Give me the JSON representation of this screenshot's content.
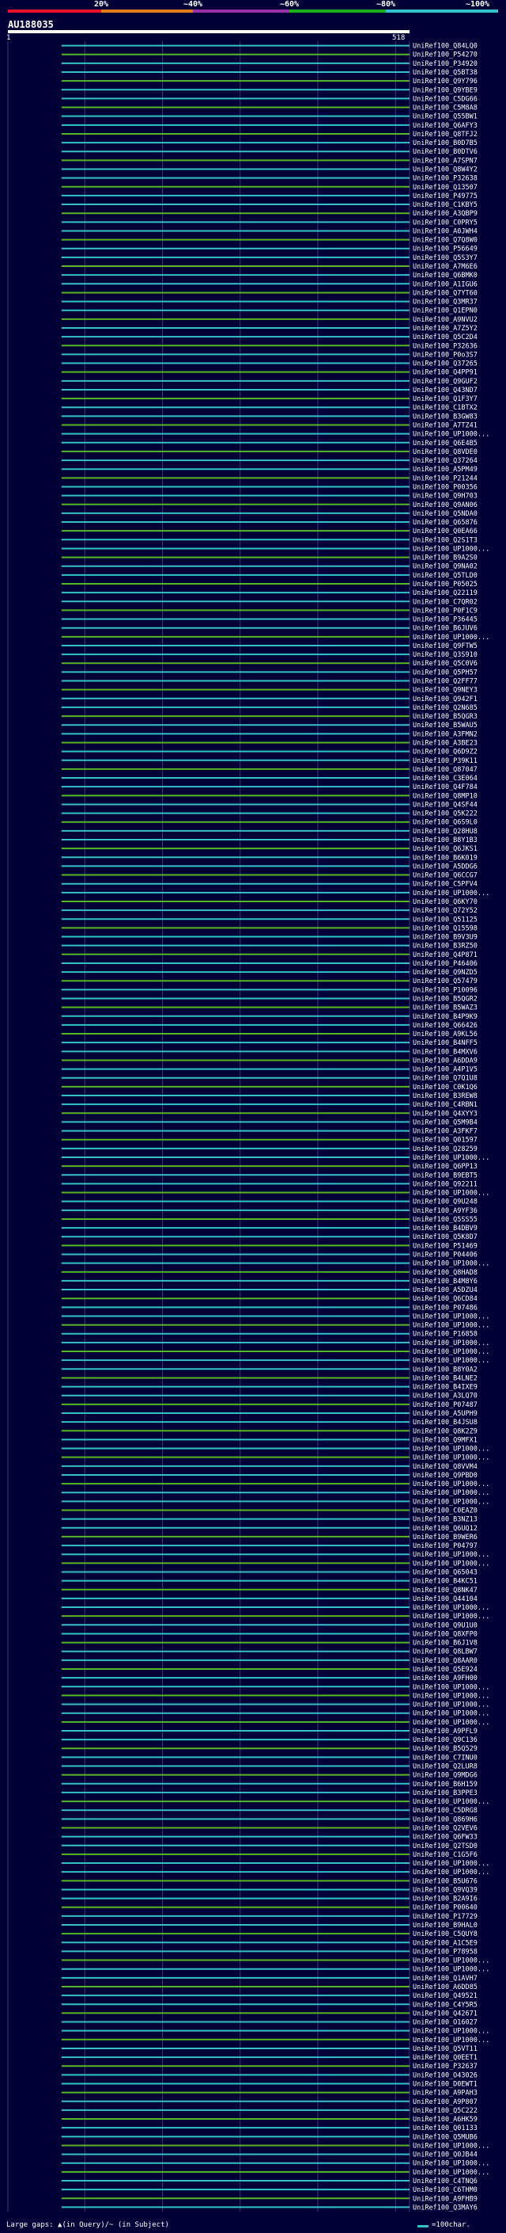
{
  "header": {
    "query_name": "AU188035",
    "query_start": "1",
    "query_end": "518",
    "percent_labels": [
      "20%",
      "~40%",
      "~60%",
      "~80%",
      "~100%"
    ],
    "percent_colors": [
      "#e8102a",
      "#e07b1c",
      "#9b2fa8",
      "#1cad1a",
      "#33c2cc"
    ]
  },
  "colors": {
    "background": "#000036",
    "query_bar": "#ffffff",
    "cyan_hit": "#33c2cc",
    "green_hit": "#55b925",
    "grid": "#3a3a7a"
  },
  "legend": {
    "gaps_text": "Large gaps: ▲(in Query)/~ (in Subject)",
    "scale_text": "=100char."
  },
  "chart_data": {
    "type": "bar",
    "title": "",
    "xlabel": "",
    "ylabel": "",
    "xlim": [
      1,
      518
    ],
    "categories": [
      "UniRef100_Q84LQ0",
      "UniRef100_P54270",
      "UniRef100_P34920",
      "UniRef100_Q5BT38",
      "UniRef100_Q9Y796",
      "UniRef100_Q9YBE9",
      "UniRef100_C5DG66",
      "UniRef100_C5M8A8",
      "UniRef100_Q55BW1",
      "UniRef100_Q6AFY3",
      "UniRef100_Q8TFJ2",
      "UniRef100_B0D7B5",
      "UniRef100_B0DTV6",
      "UniRef100_A7SPN7",
      "UniRef100_Q8W4Y2",
      "UniRef100_P32638",
      "UniRef100_Q13507",
      "UniRef100_P49775",
      "UniRef100_C1KBY5",
      "UniRef100_A3QBP9",
      "UniRef100_C0PRY5",
      "UniRef100_A0JWH4",
      "UniRef100_Q7Q8W0",
      "UniRef100_P56649",
      "UniRef100_Q5S3Y7",
      "UniRef100_A7M6E6",
      "UniRef100_Q6BMK0",
      "UniRef100_A1IGU6",
      "UniRef100_Q7YT60",
      "UniRef100_Q3MR37",
      "UniRef100_Q1EPN0",
      "UniRef100_A9NVU2",
      "UniRef100_A7Z5Y2",
      "UniRef100_Q5C2D4",
      "UniRef100_P32636",
      "UniRef100_P0o3S7",
      "UniRef100_Q37265",
      "UniRef100_Q4PP91",
      "UniRef100_Q9GUF2",
      "UniRef100_Q43ND7",
      "UniRef100_Q1F3Y7",
      "UniRef100_C1BTX2",
      "UniRef100_B3GW83",
      "UniRef100_A7TZ41",
      "UniRef100_UP1000...",
      "UniRef100_Q6E4B5",
      "UniRef100_Q8VDE0",
      "UniRef100_Q37264",
      "UniRef100_A5PM49",
      "UniRef100_P21244",
      "UniRef100_P00356",
      "UniRef100_Q9H703",
      "UniRef100_Q9AN06",
      "UniRef100_Q5NDA0",
      "UniRef100_Q65876",
      "UniRef100_Q0EA66",
      "UniRef100_Q2S1T3",
      "UniRef100_UP1000...",
      "UniRef100_B9A2S0",
      "UniRef100_Q9NA02",
      "UniRef100_Q5TLD0",
      "UniRef100_P05025",
      "UniRef100_Q22119",
      "UniRef100_C7QR02",
      "UniRef100_P0F1C9",
      "UniRef100_P36445",
      "UniRef100_B6JUV6",
      "UniRef100_UP1000...",
      "UniRef100_Q9FTW5",
      "UniRef100_Q3S910",
      "UniRef100_Q5C0V6",
      "UniRef100_Q5PH57",
      "UniRef100_Q2FF77",
      "UniRef100_Q9NEY3",
      "UniRef100_Q942F1",
      "UniRef100_Q2N685",
      "UniRef100_B5QGR3",
      "UniRef100_B5WAU5",
      "UniRef100_A3FMN2",
      "UniRef100_A3BE23",
      "UniRef100_Q6D9Z2",
      "UniRef100_P39K11",
      "UniRef100_Q87047",
      "UniRef100_C3E064",
      "UniRef100_Q4F784",
      "UniRef100_Q8MP10",
      "UniRef100_Q4SF44",
      "UniRef100_Q5K222",
      "UniRef100_Q6S9L0",
      "UniRef100_Q28HU8",
      "UniRef100_B8Y1B3",
      "UniRef100_Q6JKS1",
      "UniRef100_B6K019",
      "UniRef100_A5DDG6",
      "UniRef100_Q6CCG7",
      "UniRef100_C5PFV4",
      "UniRef100_UP1000...",
      "UniRef100_Q6KY70",
      "UniRef100_Q72Y52",
      "UniRef100_Q51125",
      "UniRef100_Q15598",
      "UniRef100_B9V3U9",
      "UniRef100_B3RZ50",
      "UniRef100_Q4P871",
      "UniRef100_P46406",
      "UniRef100_Q9NZD5",
      "UniRef100_Q57479",
      "UniRef100_P10096",
      "UniRef100_B5QGR2",
      "UniRef100_B5WAZ3",
      "UniRef100_B4P9K9",
      "UniRef100_Q66426",
      "UniRef100_A9KL56",
      "UniRef100_B4NFF5",
      "UniRef100_B4MXV6",
      "UniRef100_A6DDA9",
      "UniRef100_A4P1V5",
      "UniRef100_Q7Q1U8",
      "UniRef100_C0K1Q6",
      "UniRef100_B3REW8",
      "UniRef100_C4RBN1",
      "UniRef100_Q4XYY3",
      "UniRef100_Q5M9B4",
      "UniRef100_A3FKF7",
      "UniRef100_Q01597",
      "UniRef100_Q28259",
      "UniRef100_UP1000...",
      "UniRef100_Q6PP13",
      "UniRef100_B9EBT5",
      "UniRef100_Q92211",
      "UniRef100_UP1000...",
      "UniRef100_Q9U248",
      "UniRef100_A9YF36",
      "UniRef100_Q5SS55",
      "UniRef100_B4DBV9",
      "UniRef100_Q5K8D7",
      "UniRef100_P51469",
      "UniRef100_P04406",
      "UniRef100_UP1000...",
      "UniRef100_Q8HAD8",
      "UniRef100_B4M8Y6",
      "UniRef100_A5DZU4",
      "UniRef100_Q6CD84",
      "UniRef100_P07486",
      "UniRef100_UP1000...",
      "UniRef100_UP1000...",
      "UniRef100_P16858",
      "UniRef100_UP1000...",
      "UniRef100_UP1000...",
      "UniRef100_UP1000...",
      "UniRef100_B8Y0A2",
      "UniRef100_B4LNE2",
      "UniRef100_B4IXE9",
      "UniRef100_A3LQ70",
      "UniRef100_P07487",
      "UniRef100_A5UPH9",
      "UniRef100_B4JSU8",
      "UniRef100_Q8K2Z9",
      "UniRef100_Q9MFX1",
      "UniRef100_UP1000...",
      "UniRef100_UP1000...",
      "UniRef100_Q8VVM4",
      "UniRef100_Q9PBD0",
      "UniRef100_UP1000...",
      "UniRef100_UP1000...",
      "UniRef100_UP1000...",
      "UniRef100_C0EAZ0",
      "UniRef100_B3NZ13",
      "UniRef100_Q6UQ12",
      "UniRef100_B9WER6",
      "UniRef100_P04797",
      "UniRef100_UP1000...",
      "UniRef100_UP1000...",
      "UniRef100_Q65043",
      "UniRef100_B4KC51",
      "UniRef100_Q8NK47",
      "UniRef100_Q44104",
      "UniRef100_UP1000...",
      "UniRef100_UP1000...",
      "UniRef100_Q9U1U0",
      "UniRef100_Q8XFP0",
      "UniRef100_B6J1V8",
      "UniRef100_Q8LBW7",
      "UniRef100_Q8AAR0",
      "UniRef100_Q5E924",
      "UniRef100_A9FH00",
      "UniRef100_UP1000...",
      "UniRef100_UP1000...",
      "UniRef100_UP1000...",
      "UniRef100_UP1000...",
      "UniRef100_UP1000...",
      "UniRef100_A9PFL9",
      "UniRef100_Q9C136",
      "UniRef100_B5Q529",
      "UniRef100_C7INU0",
      "UniRef100_Q2LUR8",
      "UniRef100_Q9MDG6",
      "UniRef100_B6H159",
      "UniRef100_B3PPE3",
      "UniRef100_UP1000...",
      "UniRef100_C5DRG8",
      "UniRef100_Q869H6",
      "UniRef100_Q2VEV6",
      "UniRef100_Q6FW33",
      "UniRef100_Q2TSD0",
      "UniRef100_C1G5F6",
      "UniRef100_UP1000...",
      "UniRef100_UP1000...",
      "UniRef100_B5U676",
      "UniRef100_Q9VQ39",
      "UniRef100_B2A9I6",
      "UniRef100_P00640",
      "UniRef100_P17729",
      "UniRef100_B9HAL0",
      "UniRef100_C5QUY8",
      "UniRef100_A1C5E9",
      "UniRef100_P78958",
      "UniRef100_UP1000...",
      "UniRef100_UP1000...",
      "UniRef100_Q1AVH7",
      "UniRef100_A6DD85",
      "UniRef100_Q49521",
      "UniRef100_C4Y5R5",
      "UniRef100_Q42671",
      "UniRef100_O16027",
      "UniRef100_UP1000...",
      "UniRef100_UP1000...",
      "UniRef100_Q5VT11",
      "UniRef100_Q0EET1",
      "UniRef100_P32637",
      "UniRef100_O43026",
      "UniRef100_D0EWT1",
      "UniRef100_A9PAH3",
      "UniRef100_A9P807",
      "UniRef100_Q5C222",
      "UniRef100_A6HK59",
      "UniRef100_Q01133",
      "UniRef100_Q5MUB6",
      "UniRef100_UP1000...",
      "UniRef100_Q0JB44",
      "UniRef100_UP1000...",
      "UniRef100_UP1000...",
      "UniRef100_C4TNQ6",
      "UniRef100_C6THM0",
      "UniRef100_A9FHB9",
      "UniRef100_Q3MAY6"
    ],
    "series": []
  }
}
